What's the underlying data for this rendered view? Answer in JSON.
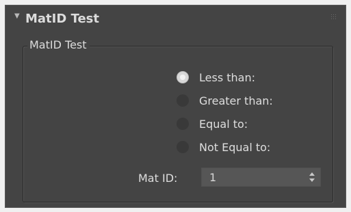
{
  "rollout": {
    "title": "MatID Test",
    "collapse_icon": "triangle-down-icon",
    "grip_icon": "drag-grip-icon"
  },
  "group": {
    "title": "MatID Test",
    "options": [
      {
        "label": "Less than:",
        "checked": true
      },
      {
        "label": "Greater than:",
        "checked": false
      },
      {
        "label": "Equal to:",
        "checked": false
      },
      {
        "label": "Not Equal to:",
        "checked": false
      }
    ]
  },
  "mat_id": {
    "label": "Mat ID:",
    "value": "1"
  },
  "colors": {
    "panel_bg": "#444444",
    "text": "#dcdcdc",
    "radio_unchecked": "#393939",
    "radio_checked": "#d8d8d8",
    "field_bg": "#565656"
  }
}
